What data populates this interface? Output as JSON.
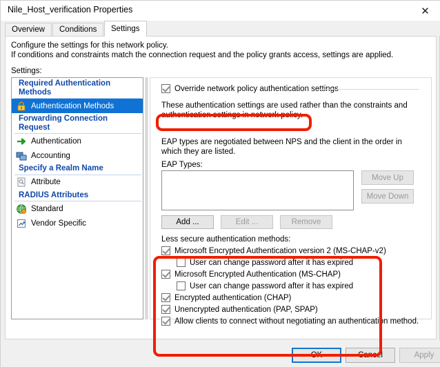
{
  "window": {
    "title": "Nile_Host_verification Properties",
    "close_icon": "close-icon"
  },
  "tabs": [
    {
      "label": "Overview",
      "active": false
    },
    {
      "label": "Conditions",
      "active": false
    },
    {
      "label": "Settings",
      "active": true
    }
  ],
  "page": {
    "description_line1": "Configure the settings for this network policy.",
    "description_line2": "If conditions and constraints match the connection request and the policy grants access, settings are applied.",
    "settings_label": "Settings:"
  },
  "sidebar": {
    "groups": [
      {
        "header": "Required Authentication Methods",
        "items": [
          {
            "label": "Authentication Methods",
            "icon": "lock-icon",
            "selected": true
          }
        ]
      },
      {
        "header": "Forwarding Connection Request",
        "items": [
          {
            "label": "Authentication",
            "icon": "green-arrow-icon",
            "selected": false
          },
          {
            "label": "Accounting",
            "icon": "accounting-icon",
            "selected": false
          }
        ]
      },
      {
        "header": "Specify a Realm Name",
        "items": [
          {
            "label": "Attribute",
            "icon": "attribute-icon",
            "selected": false
          }
        ]
      },
      {
        "header": "RADIUS Attributes",
        "items": [
          {
            "label": "Standard",
            "icon": "globe-icon",
            "selected": false
          },
          {
            "label": "Vendor Specific",
            "icon": "vendor-specific-icon",
            "selected": false
          }
        ]
      }
    ]
  },
  "settings_panel": {
    "override_checkbox": {
      "label": "Override network policy authentication settings",
      "checked": true
    },
    "paragraph1": "These authentication settings are used rather than the constraints and authentication settings in network policy.",
    "paragraph2": "EAP types are negotiated between NPS and the client in the order in which they are listed.",
    "eap_types_label": "EAP Types:",
    "eap_types_items": [],
    "buttons": {
      "move_up": {
        "label": "Move Up",
        "enabled": false
      },
      "move_down": {
        "label": "Move Down",
        "enabled": false
      },
      "add": {
        "label": "Add ...",
        "enabled": true
      },
      "edit": {
        "label": "Edit ...",
        "enabled": false
      },
      "remove": {
        "label": "Remove",
        "enabled": false
      }
    },
    "less_secure": {
      "header": "Less secure authentication methods:",
      "options": [
        {
          "label": "Microsoft Encrypted Authentication version 2 (MS-CHAP-v2)",
          "checked": true,
          "indent": false
        },
        {
          "label": "User can change password after it has expired",
          "checked": false,
          "indent": true
        },
        {
          "label": "Microsoft Encrypted Authentication (MS-CHAP)",
          "checked": true,
          "indent": false
        },
        {
          "label": "User can change password after it has expired",
          "checked": false,
          "indent": true
        },
        {
          "label": "Encrypted authentication (CHAP)",
          "checked": true,
          "indent": false
        },
        {
          "label": "Unencrypted authentication (PAP, SPAP)",
          "checked": true,
          "indent": false
        },
        {
          "label": "Allow clients to connect without negotiating an authentication method.",
          "checked": true,
          "indent": false
        }
      ]
    }
  },
  "annotations": {
    "highlight_color": "#f01e00",
    "boxes": [
      "override-authentication-settings",
      "less-secure-authentication-methods"
    ]
  },
  "footer": {
    "ok": {
      "label": "OK",
      "enabled": true,
      "focused": true
    },
    "cancel": {
      "label": "Cancel",
      "enabled": true
    },
    "apply": {
      "label": "Apply",
      "enabled": false
    }
  },
  "colors": {
    "selection_blue": "#0f72d5",
    "header_blue": "#1148a8",
    "focus_blue": "#1076d1"
  }
}
